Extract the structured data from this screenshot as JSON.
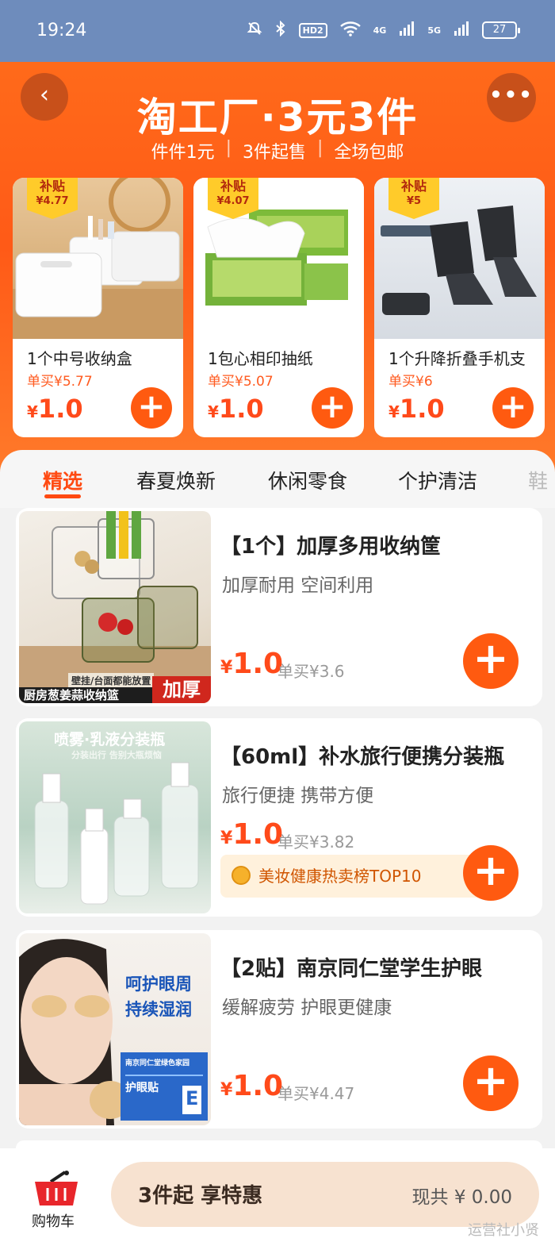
{
  "status": {
    "time": "19:24",
    "network_a": "4G",
    "network_b": "5G",
    "hd": "HD2",
    "battery": "27"
  },
  "header": {
    "title": "淘工厂·3元3件",
    "sub_items": [
      "件件1元",
      "3件起售",
      "全场包邮"
    ],
    "sep": "|",
    "back_glyph": "‹",
    "more_glyph": "•••"
  },
  "deals": [
    {
      "tag_label": "补贴",
      "tag_amount": "¥4.77",
      "name": "1个中号收纳盒",
      "single": "单买¥5.77",
      "price_sym": "¥",
      "price": "1.0"
    },
    {
      "tag_label": "补贴",
      "tag_amount": "¥4.07",
      "name": "1包心相印抽纸",
      "single": "单买¥5.07",
      "price_sym": "¥",
      "price": "1.0"
    },
    {
      "tag_label": "补贴",
      "tag_amount": "¥5",
      "name": "1个升降折叠手机支",
      "single": "单买¥6",
      "price_sym": "¥",
      "price": "1.0"
    }
  ],
  "tabs": [
    "精选",
    "春夏焕新",
    "休闲零食",
    "个护清洁",
    "鞋"
  ],
  "products": [
    {
      "title": "【1个】加厚多用收纳筐",
      "subtitle": "加厚耐用 空间利用",
      "price_sym": "¥",
      "price": "1.0",
      "single": "单买¥3.6",
      "img_caption": "厨房葱姜蒜收纳篮",
      "img_small": "壁挂/台面都能放置",
      "img_badge": "加厚"
    },
    {
      "title": "【60ml】补水旅行便携分装瓶",
      "subtitle": "旅行便捷 携带方便",
      "price_sym": "¥",
      "price": "1.0",
      "single": "单买¥3.82",
      "rank": "美妆健康热卖榜TOP10",
      "img_title": "喷雾·乳液分装瓶",
      "img_small": "分装出行 告别大瓶烦恼"
    },
    {
      "title": "【2贴】南京同仁堂学生护眼",
      "subtitle": "缓解疲劳 护眼更健康",
      "price_sym": "¥",
      "price": "1.0",
      "single": "单买¥4.47",
      "img_line1": "呵护眼周",
      "img_line2": "持续湿润",
      "img_box": "护眼贴",
      "img_box_top": "南京同仁堂绿色家园",
      "img_box_letter": "E"
    }
  ],
  "bottom": {
    "cart_label": "购物车",
    "checkout_label": "3件起 享特惠",
    "total_label": "现共 ¥ 0.00"
  },
  "watermark": "运营社小贤",
  "colors": {
    "accent": "#ff5a10",
    "header": "#ff6a1a",
    "status": "#6e8cbc"
  }
}
